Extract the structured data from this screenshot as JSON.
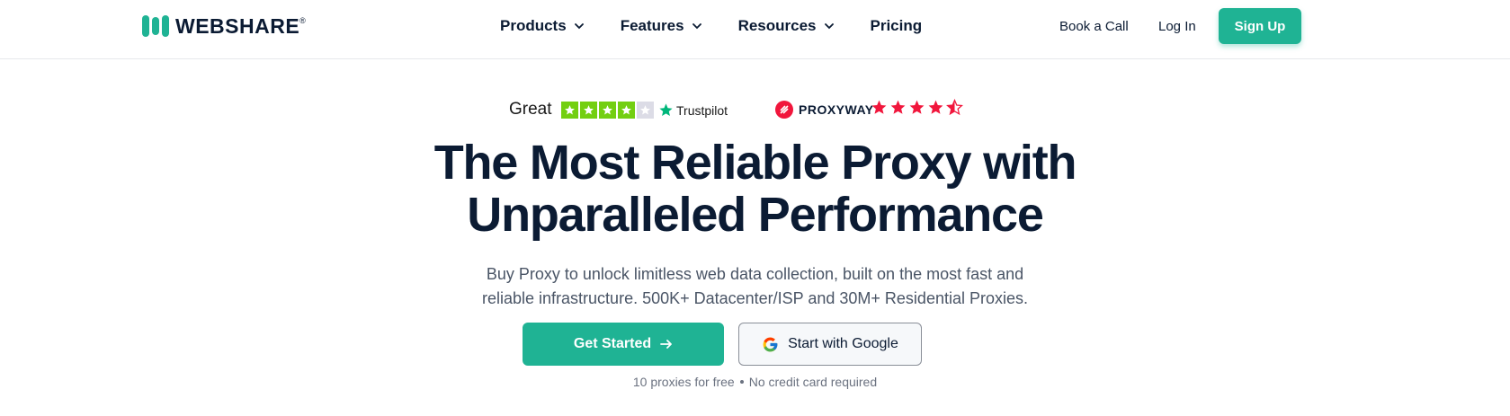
{
  "header": {
    "logo_text": "WEBSHARE",
    "logo_mark": "®",
    "nav": [
      {
        "label": "Products",
        "icon": "chevron-down-icon"
      },
      {
        "label": "Features",
        "icon": "chevron-down-icon"
      },
      {
        "label": "Resources",
        "icon": "chevron-down-icon"
      },
      {
        "label": "Pricing"
      }
    ],
    "book_call": "Book a Call",
    "login": "Log In",
    "signup": "Sign Up"
  },
  "ratings": {
    "trustpilot": {
      "label": "Great",
      "brand": "Trustpilot",
      "stars": 4,
      "max": 5
    },
    "proxyway": {
      "brand": "PROXYWAY",
      "stars": 4.5,
      "max": 5
    }
  },
  "hero": {
    "title_line1": "The Most Reliable Proxy with",
    "title_line2": "Unparalleled Performance",
    "subtitle_line1": "Buy Proxy to unlock limitless web data collection, built on the most fast and",
    "subtitle_line2": "reliable infrastructure. 500K+ Datacenter/ISP and 30M+ Residential Proxies.",
    "cta_primary": "Get Started",
    "cta_google": "Start with Google",
    "note_1": "10 proxies for free",
    "note_2": "No credit card required"
  },
  "colors": {
    "brand": "#1fb394",
    "text": "#0b1b33",
    "trustpilot_green": "#73cf11",
    "proxyway_red": "#f1163c"
  }
}
